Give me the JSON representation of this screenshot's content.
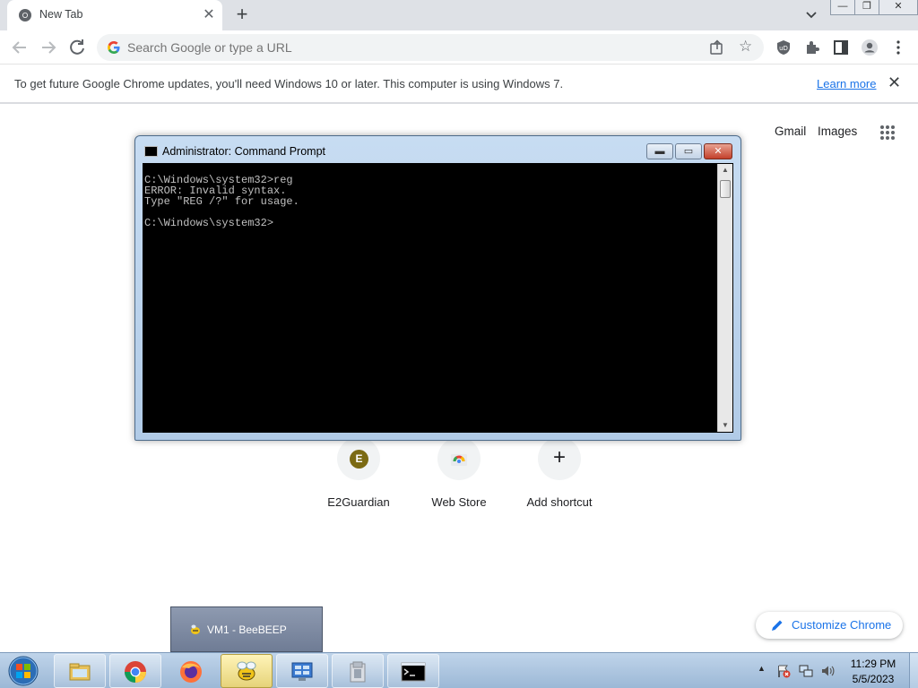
{
  "browser": {
    "tab": {
      "title": "New Tab",
      "close": "✕"
    },
    "new_tab": "+",
    "window_controls": {
      "minimize": "—",
      "restore": "❐",
      "close": "✕"
    },
    "omnibox": {
      "placeholder": "Search Google or type a URL"
    }
  },
  "infobar": {
    "message": "To get future Google Chrome updates, you'll need Windows 10 or later. This computer is using Windows 7.",
    "link": "Learn more",
    "close": "✕"
  },
  "ntp": {
    "gmail": "Gmail",
    "images": "Images",
    "shortcuts": [
      {
        "label": "E2Guardian",
        "initial": "E",
        "icon": "e2guardian-favicon",
        "initial_bg": "#7b6a13"
      },
      {
        "label": "Web Store",
        "icon": "web-store-icon"
      },
      {
        "label": "Add shortcut",
        "icon": "plus-icon",
        "symbol": "+"
      }
    ],
    "customize": "Customize Chrome"
  },
  "cmd": {
    "title": "Administrator:  Command Prompt",
    "output": "C:\\Windows\\system32>reg\nERROR: Invalid syntax.\nType \"REG /?\" for usage.\n\nC:\\Windows\\system32>"
  },
  "taskbar": {
    "thumbnail": "VM1 - BeeBEEP",
    "apps": [
      "explorer-icon",
      "chrome-icon",
      "firefox-icon",
      "beebeep-icon",
      "control-panel-icon",
      "file-archive-icon",
      "cmd-icon"
    ],
    "clock": {
      "time": "11:29 PM",
      "date": "5/5/2023"
    }
  },
  "colors": {
    "link": "#1a73e8",
    "cmd_bg": "#000000",
    "cmd_fg": "#c0c0c0",
    "taskbar": "#a9c2df"
  }
}
